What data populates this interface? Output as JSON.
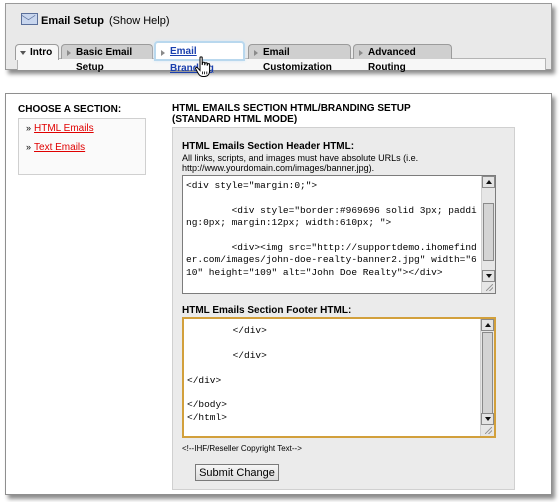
{
  "header": {
    "title": "Email Setup",
    "help_link": "(Show Help)",
    "tabs": [
      {
        "label": "Intro"
      },
      {
        "label": "Basic Email Setup"
      },
      {
        "label": "Email Branding"
      },
      {
        "label": "Email Customization"
      },
      {
        "label": "Advanced Routing"
      }
    ]
  },
  "sidebar": {
    "heading": "CHOOSE A SECTION:",
    "items": [
      {
        "label": "HTML Emails"
      },
      {
        "label": "Text Emails"
      }
    ]
  },
  "main": {
    "title": "HTML EMAILS SECTION HTML/BRANDING SETUP (STANDARD HTML MODE)",
    "header_html_label": "HTML Emails Section Header HTML:",
    "header_html_desc": "All links, scripts, and images must have absolute URLs (i.e. http://www.yourdomain.com/images/banner.jpg).",
    "header_html_value": "<div style=\"margin:0;\">\n\n        <div style=\"border:#969696 solid 3px; padding:0px; margin:12px; width:610px; \">\n\n        <div><img src=\"http://supportdemo.ihomefinder.com/images/john-doe-realty-banner2.jpg\" width=\"610\" height=\"109\" alt=\"John Doe Realty\"></div>",
    "footer_html_label": "HTML Emails Section Footer HTML:",
    "footer_html_value": "        </div>\n\n        </div>\n\n</div>\n\n</body>\n</html>",
    "copyright_text": "<!--IHF/Reseller Copyright Text-->",
    "submit_label": "Submit Change"
  }
}
